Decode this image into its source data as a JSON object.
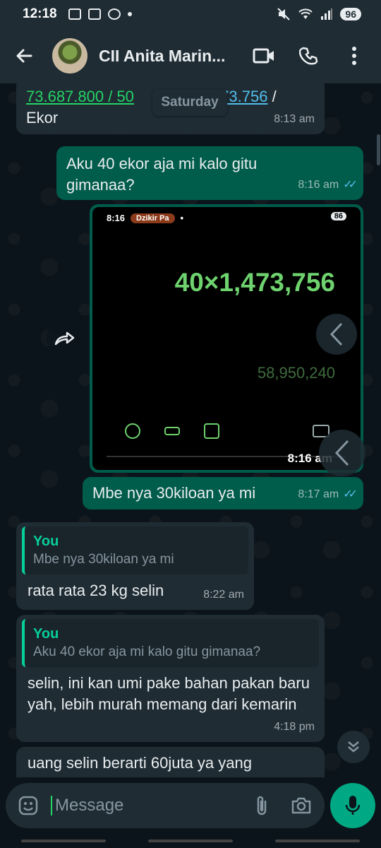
{
  "status_bar": {
    "time": "12:18",
    "battery": "96"
  },
  "header": {
    "contact_name": "CII Anita Marin..."
  },
  "date_chip": "Saturday",
  "messages": {
    "m1": {
      "line1_a": "73.687.800 / 50",
      "line1_b": "473.756",
      "line1_c": " /",
      "line2": "Ekor",
      "time": "8:13 am"
    },
    "m2": {
      "text": "Aku 40 ekor aja mi kalo gitu gimanaa?",
      "time": "8:16 am"
    },
    "m3_image": {
      "status_time": "8:16",
      "status_app": "Dzikir Pa",
      "battery": "86",
      "expression": "40×1,473,756",
      "result": "58,950,240",
      "time": "8:16 am"
    },
    "m4": {
      "text": "Mbe nya 30kiloan ya mi",
      "time": "8:17 am"
    },
    "m5": {
      "quote_author": "You",
      "quote_text": "Mbe nya 30kiloan ya mi",
      "text": "rata rata 23 kg selin",
      "time": "8:22 am"
    },
    "m6": {
      "quote_author": "You",
      "quote_text": "Aku 40 ekor aja mi kalo gitu gimanaa?",
      "text": "selin, ini kan umi pake bahan pakan baru yah, lebih murah memang dari kemarin",
      "time": "4:18 pm"
    },
    "m7": {
      "text": "uang selin berarti 60juta ya yang"
    }
  },
  "composer": {
    "placeholder": "Message"
  },
  "colors": {
    "incoming": "#1f2c34",
    "outgoing": "#005c4b",
    "accent": "#00a884",
    "ticks": "#53bdeb"
  }
}
